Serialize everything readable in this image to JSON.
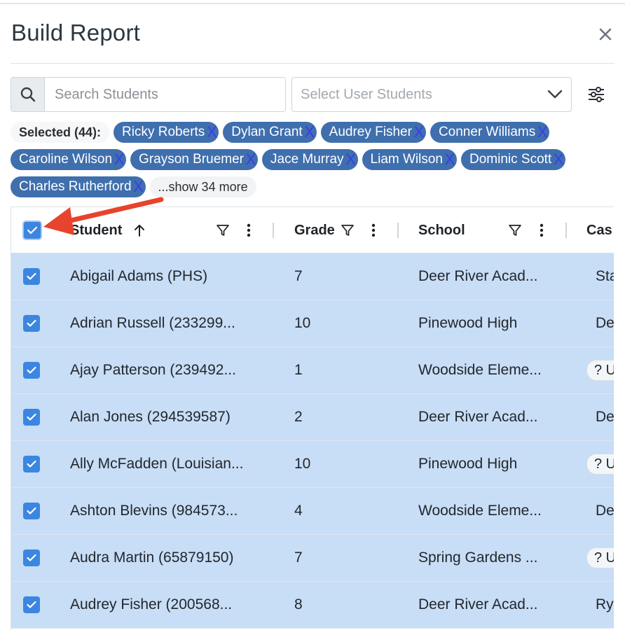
{
  "modal": {
    "title": "Build Report",
    "close_icon": "close-icon"
  },
  "search": {
    "placeholder": "Search Students",
    "value": ""
  },
  "user_select": {
    "placeholder": "Select User Students"
  },
  "selected": {
    "label": "Selected (44):",
    "chips": [
      "Ricky Roberts",
      "Dylan Grant",
      "Audrey Fisher",
      "Conner Williams",
      "Caroline Wilson",
      "Grayson Bruemer",
      "Jace Murray",
      "Liam Wilson",
      "Dominic Scott",
      "Charles Rutherford"
    ],
    "remove_glyph": "X",
    "more_label": "...show 34 more"
  },
  "table": {
    "columns": {
      "student": "Student",
      "grade": "Grade",
      "school": "School",
      "case": "Cas"
    },
    "sort": {
      "column": "student",
      "direction": "ascending"
    },
    "all_selected": true,
    "rows": [
      {
        "student": "Abigail Adams (PHS)",
        "grade": "7",
        "school": "Deer River Acad...",
        "case": "Sta",
        "case_pill": false
      },
      {
        "student": "Adrian Russell (233299...",
        "grade": "10",
        "school": "Pinewood High",
        "case": "De",
        "case_pill": false
      },
      {
        "student": "Ajay Patterson (239492...",
        "grade": "1",
        "school": "Woodside Eleme...",
        "case": "? U",
        "case_pill": true
      },
      {
        "student": "Alan Jones (294539587)",
        "grade": "2",
        "school": "Deer River Acad...",
        "case": "De",
        "case_pill": false
      },
      {
        "student": "Ally McFadden (Louisian...",
        "grade": "10",
        "school": "Pinewood High",
        "case": "? U",
        "case_pill": true
      },
      {
        "student": "Ashton Blevins (984573...",
        "grade": "4",
        "school": "Woodside Eleme...",
        "case": "De",
        "case_pill": false
      },
      {
        "student": "Audra Martin (65879150)",
        "grade": "7",
        "school": "Spring Gardens ...",
        "case": "? U",
        "case_pill": true
      },
      {
        "student": "Audrey Fisher (200568...",
        "grade": "8",
        "school": "Deer River Acad...",
        "case": "Ry",
        "case_pill": false
      }
    ]
  },
  "colors": {
    "chip_bg": "#3f6fad",
    "row_selected_bg": "#c8ddf6",
    "checkbox": "#3b86e0",
    "annotation_arrow": "#e8432c"
  }
}
